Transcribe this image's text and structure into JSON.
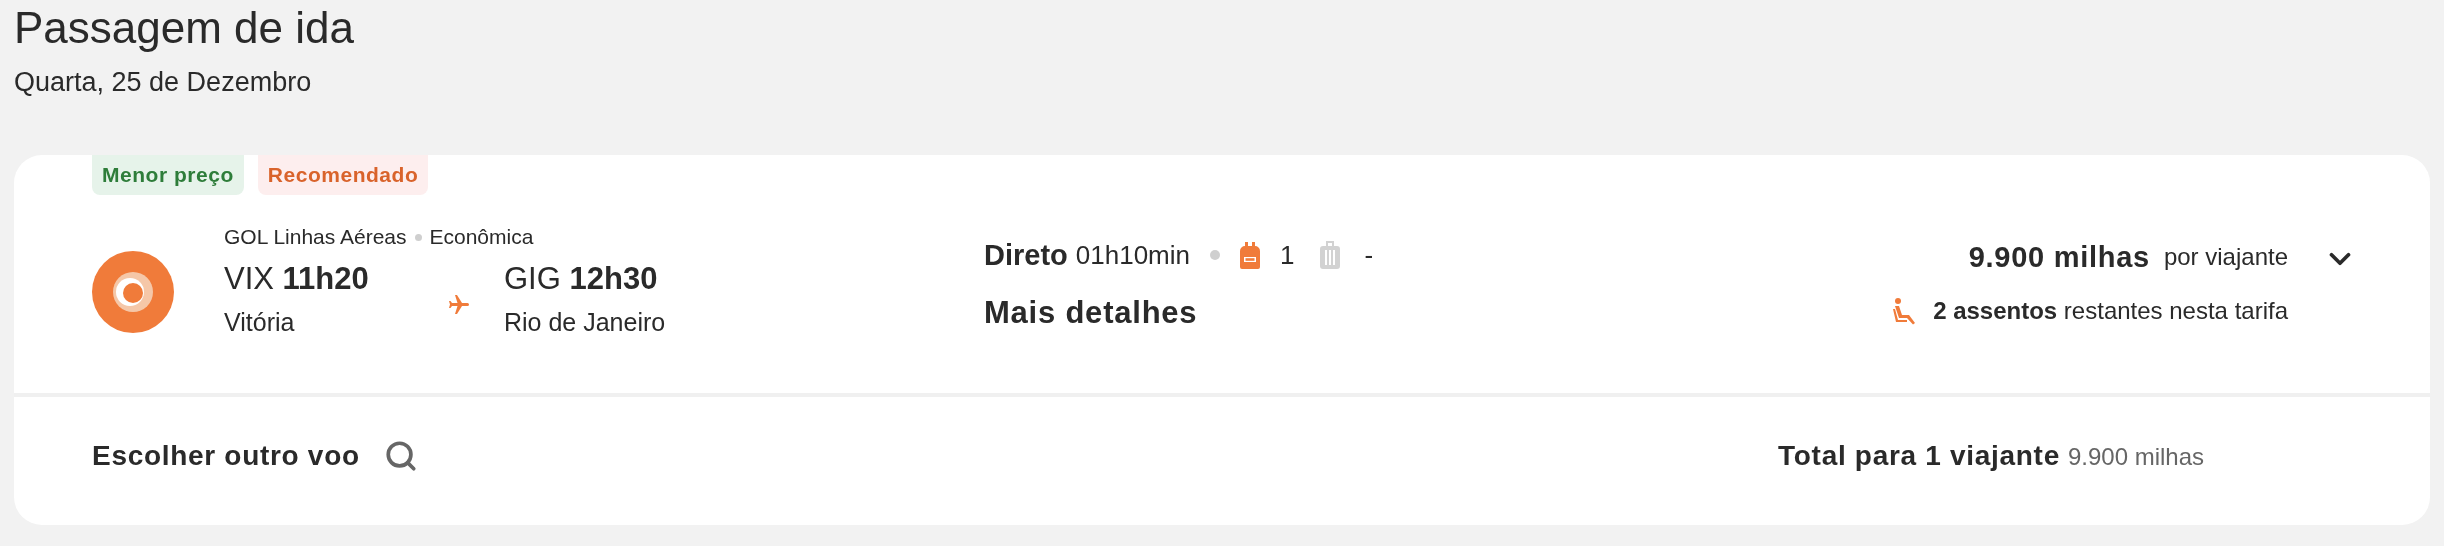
{
  "page": {
    "title": "Passagem de ida",
    "date": "Quarta, 25 de Dezembro"
  },
  "flight": {
    "badges": [
      {
        "label": "Menor preço",
        "kind": "best_price"
      },
      {
        "label": "Recomendado",
        "kind": "recommended"
      }
    ],
    "airline": "GOL Linhas Aéreas",
    "cabin": "Econômica",
    "origin": {
      "code": "VIX",
      "time": "11h20",
      "city": "Vitória"
    },
    "destination": {
      "code": "GIG",
      "time": "12h30",
      "city": "Rio de Janeiro"
    },
    "stops": "Direto",
    "duration": "01h10min",
    "carry_on": "1",
    "checked_bag": "-",
    "details_link": "Mais detalhes",
    "price": "9.900 milhas",
    "price_unit": "por viajante",
    "seats": "**2 assentos** restantes nesta tarifa",
    "expanded": false
  },
  "footer": {
    "change_flight": "Escolher outro voo",
    "total_label": "Total para 1 viajante",
    "total_value": "9.900 milhas"
  }
}
